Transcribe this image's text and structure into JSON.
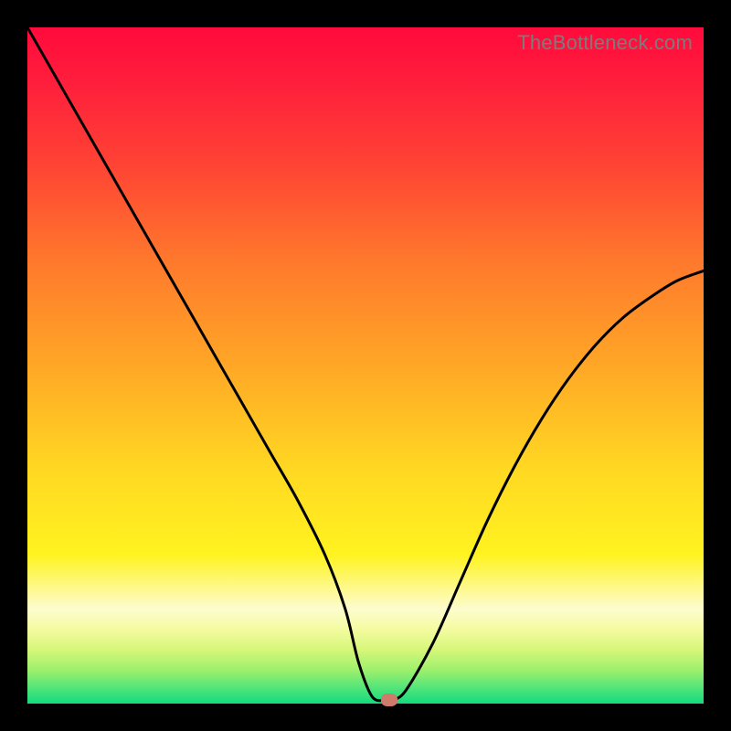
{
  "watermark": "TheBottleneck.com",
  "chart_data": {
    "type": "line",
    "title": "",
    "xlabel": "",
    "ylabel": "",
    "xlim": [
      0,
      100
    ],
    "ylim": [
      0,
      100
    ],
    "grid": false,
    "series": [
      {
        "name": "bottleneck-curve",
        "x": [
          0,
          4,
          8,
          12,
          16,
          20,
          24,
          28,
          32,
          36,
          40,
          44,
          47,
          49,
          51,
          53,
          54,
          56,
          60,
          64,
          68,
          72,
          76,
          80,
          84,
          88,
          92,
          96,
          100
        ],
        "y": [
          100,
          93,
          86,
          79,
          72,
          65,
          58,
          51,
          44,
          37,
          30,
          22,
          14,
          6,
          1,
          0.5,
          0.5,
          2,
          9,
          18,
          27,
          35,
          42,
          48,
          53,
          57,
          60,
          62.5,
          64
        ]
      }
    ],
    "marker": {
      "x": 53.5,
      "y": 0.6,
      "color": "#cf7a6a"
    },
    "gradient_stops": [
      {
        "pos": 0,
        "color": "#ff0a3c"
      },
      {
        "pos": 8,
        "color": "#ff1e3c"
      },
      {
        "pos": 20,
        "color": "#ff4234"
      },
      {
        "pos": 35,
        "color": "#ff7a2c"
      },
      {
        "pos": 50,
        "color": "#ffa726"
      },
      {
        "pos": 65,
        "color": "#ffd722"
      },
      {
        "pos": 78,
        "color": "#fff320"
      },
      {
        "pos": 86,
        "color": "#fdfccf"
      },
      {
        "pos": 89,
        "color": "#f5fba0"
      },
      {
        "pos": 92,
        "color": "#d6f77a"
      },
      {
        "pos": 95,
        "color": "#9ff06d"
      },
      {
        "pos": 98,
        "color": "#49e37a"
      },
      {
        "pos": 100,
        "color": "#13db7d"
      }
    ]
  }
}
